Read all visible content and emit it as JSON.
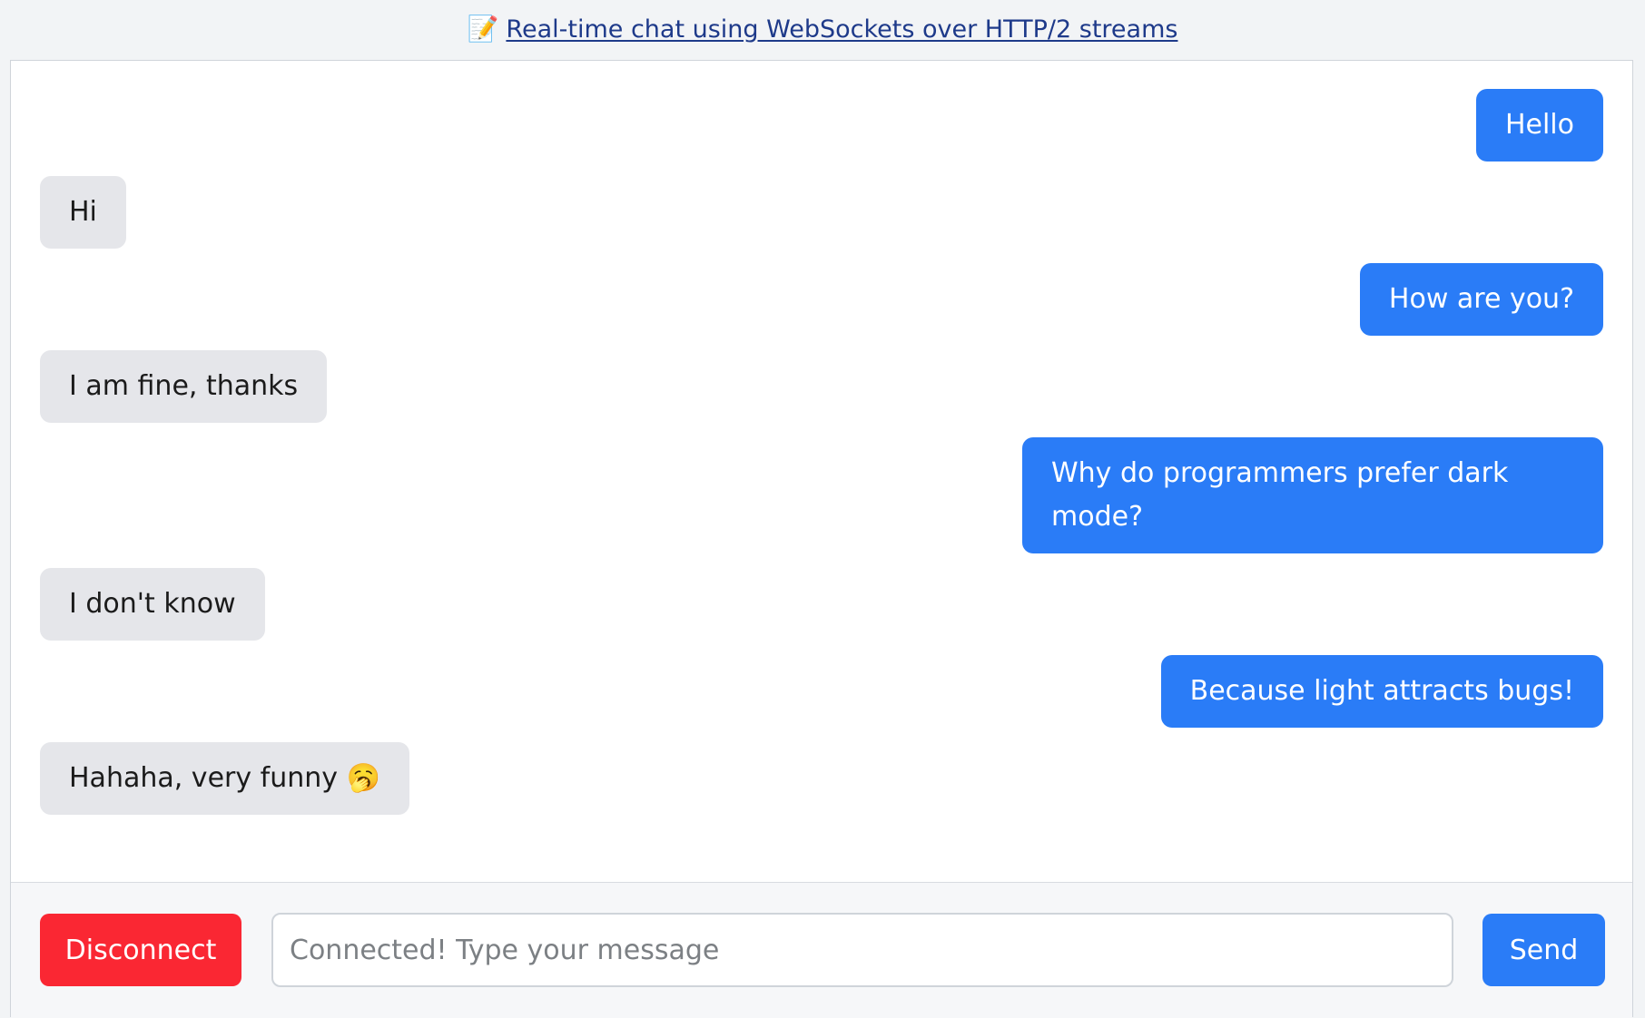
{
  "header": {
    "icon": "memo-icon",
    "icon_glyph": "📝",
    "link_text": "Real-time chat using WebSockets over HTTP/2 streams"
  },
  "messages": [
    {
      "direction": "out",
      "text": "Hello"
    },
    {
      "direction": "in",
      "text": "Hi"
    },
    {
      "direction": "out",
      "text": "How are you?"
    },
    {
      "direction": "in",
      "text": "I am fine, thanks"
    },
    {
      "direction": "out",
      "text": "Why do programmers prefer dark mode?"
    },
    {
      "direction": "in",
      "text": "I don't know"
    },
    {
      "direction": "out",
      "text": "Because light attracts bugs!"
    },
    {
      "direction": "in",
      "text": "Hahaha, very funny 🥱"
    }
  ],
  "composer": {
    "disconnect_label": "Disconnect",
    "input_placeholder": "Connected! Type your message",
    "input_value": "",
    "send_label": "Send"
  },
  "colors": {
    "outgoing_bubble": "#2a7cf7",
    "incoming_bubble": "#e5e6ea",
    "disconnect": "#fa2733",
    "send": "#2a7cf7",
    "link": "#1e3a8a"
  }
}
